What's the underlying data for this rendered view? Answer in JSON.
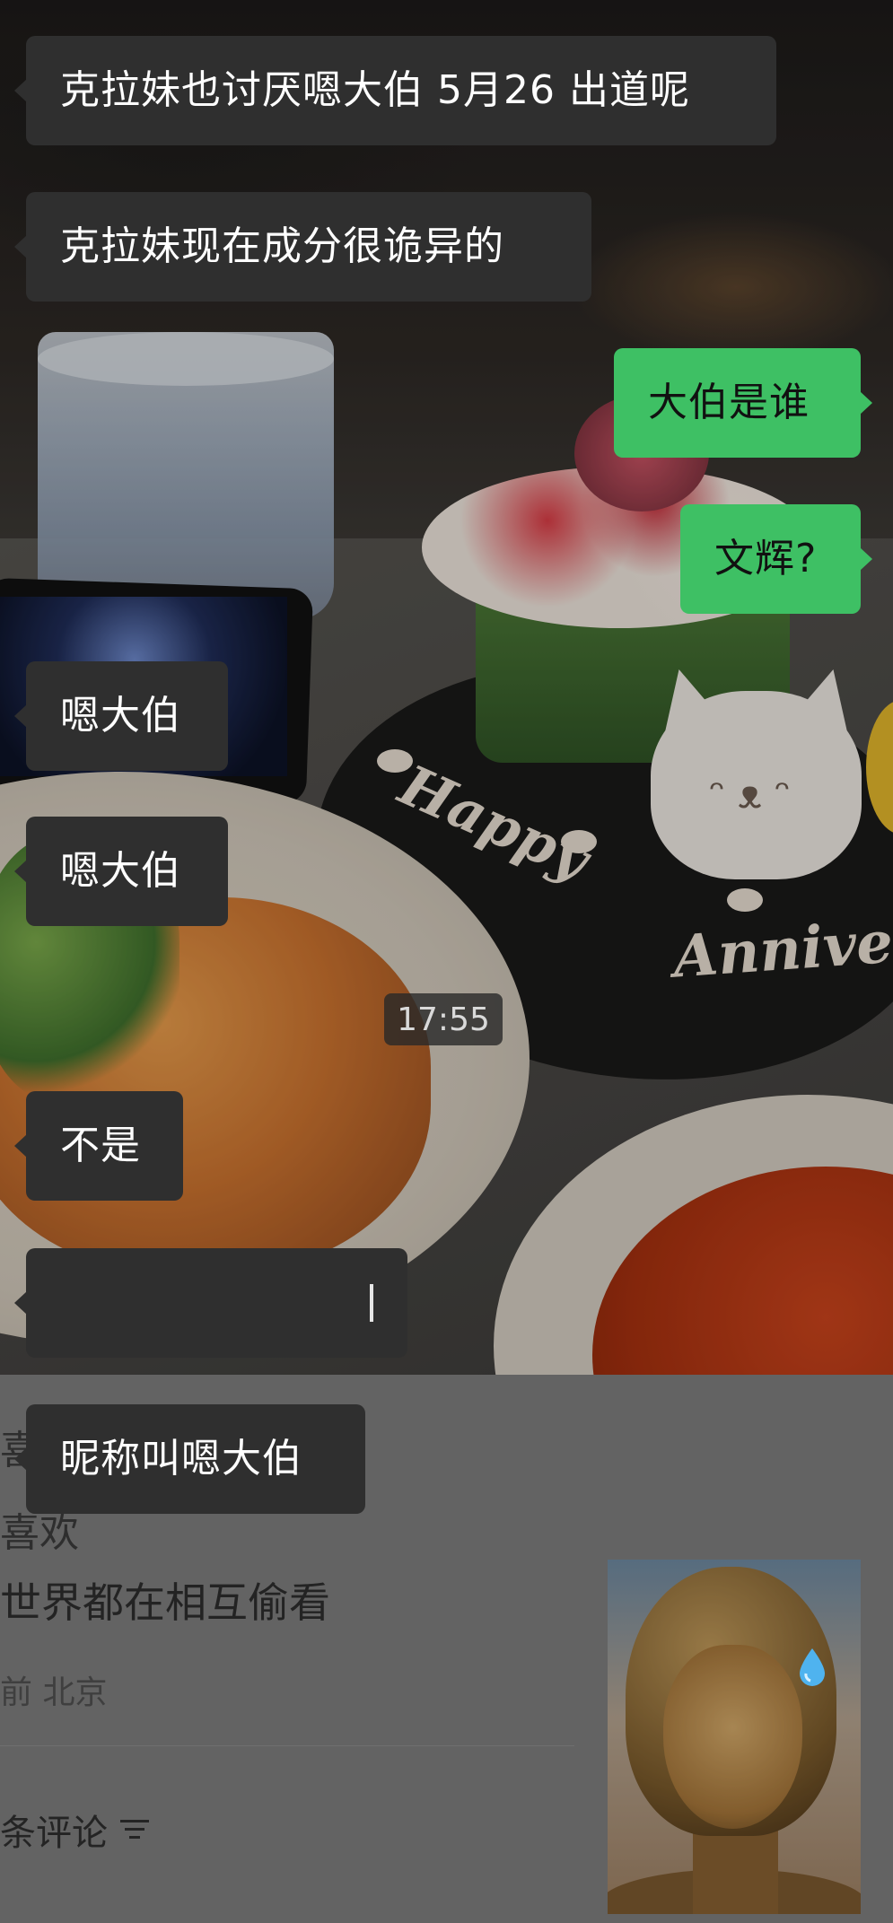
{
  "messages": [
    {
      "side": "left",
      "text": "克拉妹也讨厌嗯大伯 5月26 出道呢"
    },
    {
      "side": "left",
      "text": "克拉妹现在成分很诡异的"
    },
    {
      "side": "right",
      "text": "大伯是谁"
    },
    {
      "side": "right",
      "text": "文辉?"
    },
    {
      "side": "left",
      "text": "嗯大伯"
    },
    {
      "side": "left",
      "text": "嗯大伯"
    },
    {
      "side": "left",
      "text": "不是"
    },
    {
      "side": "left",
      "text": ""
    },
    {
      "side": "left",
      "text": "昵称叫嗯大伯"
    }
  ],
  "timestamp": "17:55",
  "background_photo": {
    "icing_happy": "Happy",
    "icing_anniversary": "Anniver"
  },
  "feed": {
    "line1": "喜",
    "line2": "喜欢",
    "line3": "世界都在相互偷看",
    "meta": "前 北京",
    "comments_label": "条评论",
    "comments_icon": "filter-icon"
  },
  "colors": {
    "bubble_left": "#2f2f2f",
    "bubble_right": "#3ec064",
    "overlay": "#636363"
  }
}
